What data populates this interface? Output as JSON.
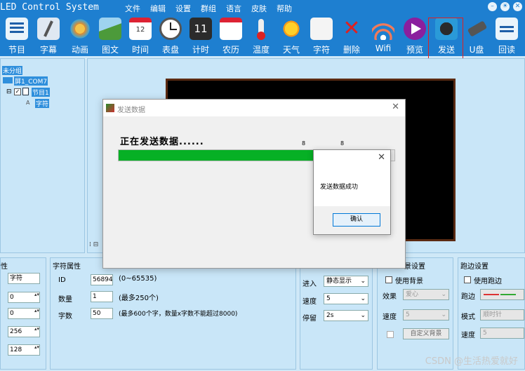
{
  "app": {
    "title": "LED Control System"
  },
  "menu": [
    "文件",
    "编辑",
    "设置",
    "群组",
    "语言",
    "皮肤",
    "帮助"
  ],
  "window_buttons": [
    "minimize",
    "skin",
    "close"
  ],
  "toolbar": [
    {
      "label": "节目",
      "icon": "program-icon"
    },
    {
      "label": "字幕",
      "icon": "subtitle-icon"
    },
    {
      "label": "动画",
      "icon": "animation-icon"
    },
    {
      "label": "图文",
      "icon": "image-text-icon"
    },
    {
      "label": "时间",
      "icon": "calendar-icon"
    },
    {
      "label": "表盘",
      "icon": "clock-icon"
    },
    {
      "label": "计时",
      "icon": "timer-icon"
    },
    {
      "label": "农历",
      "icon": "lunar-calendar-icon"
    },
    {
      "label": "温度",
      "icon": "thermometer-icon"
    },
    {
      "label": "天气",
      "icon": "sun-icon"
    },
    {
      "label": "字符",
      "icon": "character-icon"
    },
    {
      "label": "删除",
      "icon": "delete-icon"
    },
    {
      "label": "Wifi",
      "icon": "wifi-icon"
    },
    {
      "label": "预览",
      "icon": "preview-icon"
    },
    {
      "label": "发送",
      "icon": "send-icon"
    },
    {
      "label": "U盘",
      "icon": "usb-drive-icon"
    },
    {
      "label": "回读",
      "icon": "read-back-icon"
    }
  ],
  "tree": {
    "root": "未分组",
    "screen": "屏1_COM7",
    "program": "节目1",
    "item": "字符"
  },
  "props_left": {
    "header": "性",
    "name_value": "字符",
    "values": [
      "0",
      "0",
      "256",
      "128"
    ]
  },
  "char_props": {
    "header": "字符属性",
    "id_label": "ID",
    "id_value": "56894",
    "id_hint": "(0~65535)",
    "count_label": "数量",
    "count_value": "1",
    "count_hint": "(最多250个)",
    "chars_label": "字数",
    "chars_value": "50",
    "chars_hint": "(最多600个字，数量x字数不能超过8000)"
  },
  "effects": {
    "enter_label": "进入",
    "enter_value": "静态显示",
    "speed_label": "速度",
    "speed_value": "5",
    "stay_label": "停留",
    "stay_value": "2s"
  },
  "bg_settings": {
    "header": "景设置",
    "use_bg": "使用背景",
    "effect_label": "效果",
    "effect_value": "爱心",
    "speed_label": "速度",
    "speed_value": "5",
    "custom_button": "自定义背景"
  },
  "border_settings": {
    "header": "跑边设置",
    "use_border": "使用跑边",
    "border_label": "跑边",
    "mode_label": "模式",
    "mode_value": "顺时针",
    "speed_label": "速度",
    "speed_value": "5"
  },
  "send_dialog": {
    "title": "发送数据",
    "status": "正在发送数据......",
    "tick_left": "8",
    "tick_right": "8",
    "progress": 0.78
  },
  "success_dialog": {
    "message": "发送数据成功",
    "ok": "确认"
  },
  "watermark": "CSDN @生活热爱就好",
  "colors": {
    "titlebar": "#1e7fd0",
    "panel": "#c9e6f8",
    "progress": "#06b025",
    "highlight": "#e02020"
  }
}
